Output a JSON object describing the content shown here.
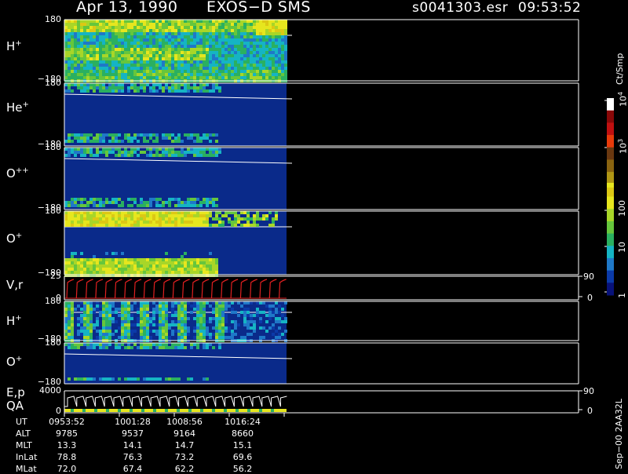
{
  "header": {
    "date": "Apr 13, 1990",
    "instrument": "EXOS−D SMS",
    "filename": "s0041303.esr",
    "time": "09:53:52"
  },
  "colors": {
    "background": "#000000",
    "fill": "#0a2a8a",
    "palette": [
      "#08127a",
      "#0b3aa8",
      "#1f78c8",
      "#15b4c4",
      "#2ab060",
      "#66c63c",
      "#a8d628",
      "#e6e61e",
      "#dcc814",
      "#b09614",
      "#8a6410",
      "#6a3810",
      "#e83a0a",
      "#c01010",
      "#8a0808",
      "#ffffff"
    ]
  },
  "panels": [
    {
      "label": "H",
      "charge": "+",
      "top": "180",
      "bottom": "−180"
    },
    {
      "label": "He",
      "charge": "+",
      "top": "180",
      "bottom": "−180"
    },
    {
      "label": "O",
      "charge": "++",
      "top": "180",
      "bottom": "−180"
    },
    {
      "label": "O",
      "charge": "+",
      "top": "180",
      "bottom": "−180"
    },
    {
      "label": "V,r",
      "charge": "",
      "top": "25",
      "bottom": "0",
      "rtop": "90",
      "rbottom": "0"
    },
    {
      "label": "H",
      "charge": "+",
      "top": "180",
      "bottom": "−180"
    },
    {
      "label": "O",
      "charge": "+",
      "top": "180",
      "bottom": "−180"
    },
    {
      "label": "E,p",
      "label2": "QA",
      "charge": "",
      "top": "4000",
      "bottom": "0",
      "rtop": "90",
      "rbottom": "0"
    }
  ],
  "colorbar": {
    "unit": "Ct/Smp",
    "ticks": [
      {
        "label": "10",
        "sup": "4"
      },
      {
        "label": "10",
        "sup": "3"
      },
      {
        "label": "100",
        "sup": ""
      },
      {
        "label": "10",
        "sup": ""
      },
      {
        "label": "1",
        "sup": ""
      }
    ]
  },
  "ephemeris": {
    "rows": [
      {
        "name": "UT",
        "values": [
          "0953:52",
          "1001:28",
          "1008:56",
          "1016:24"
        ]
      },
      {
        "name": "ALT",
        "values": [
          "9785",
          "9537",
          "9164",
          "8660"
        ]
      },
      {
        "name": "MLT",
        "values": [
          "13.3",
          "14.1",
          "14.7",
          "15.1"
        ]
      },
      {
        "name": "InLat",
        "values": [
          "78.8",
          "76.3",
          "73.2",
          "69.6"
        ]
      },
      {
        "name": "MLat",
        "values": [
          "72.0",
          "67.4",
          "62.2",
          "56.2"
        ]
      }
    ]
  },
  "footer": {
    "note": "Sep−00  2AA32L"
  },
  "chart_data": {
    "type": "heatmap",
    "title": "Apr 13, 1990   EXOS−D SMS",
    "x": [
      "0953:52",
      "1001:28",
      "1008:56",
      "1016:24"
    ],
    "panels": [
      "H+",
      "He+",
      "O++",
      "O+",
      "V,r",
      "H+",
      "O+",
      "E,p QA"
    ],
    "y_range": [
      -180,
      180
    ],
    "colorbar_range": [
      1,
      10000
    ],
    "colorbar_scale": "log",
    "grid": false
  }
}
